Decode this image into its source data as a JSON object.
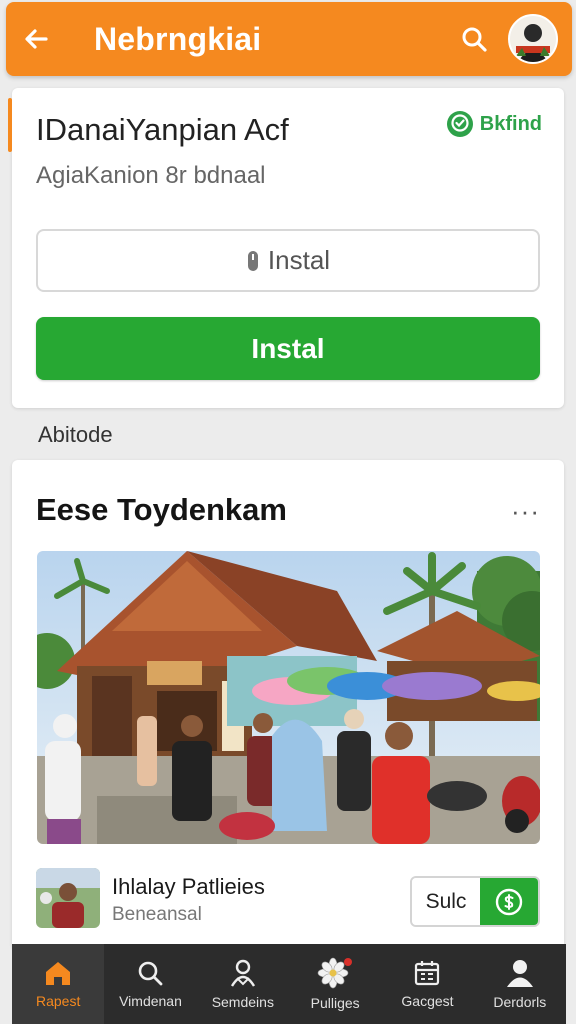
{
  "header": {
    "title": "Nebrngkiai",
    "back_icon": "arrow-left-icon",
    "search_icon": "search-icon",
    "avatar_icon": "avatar"
  },
  "app": {
    "name": "IDanaiYanpian Acf",
    "subtitle": "AgiaKanion 8r bdnaal",
    "badge_label": "Bkfind",
    "badge_color": "#2ea24a",
    "secondary_button_label": "Instal",
    "primary_button_label": "Instal",
    "primary_color": "#27a833",
    "accent_color": "#f5891f"
  },
  "section": {
    "label": "Abitode"
  },
  "post": {
    "title": "Eese Toydenkam",
    "more_label": "···",
    "footer": {
      "title": "Ihlalay Patlieies",
      "subtitle": "Beneansal",
      "button_label": "Sulc"
    }
  },
  "bottom_nav": {
    "items": [
      {
        "label": "Rapest",
        "icon": "home-icon",
        "active": true
      },
      {
        "label": "Vimdenan",
        "icon": "search-icon",
        "active": false
      },
      {
        "label": "Semdeins",
        "icon": "people-icon",
        "active": false
      },
      {
        "label": "Pulliges",
        "icon": "flower-icon",
        "active": false
      },
      {
        "label": "Gacgest",
        "icon": "calendar-icon",
        "active": false
      },
      {
        "label": "Derdorls",
        "icon": "profile-icon",
        "active": false
      }
    ]
  }
}
